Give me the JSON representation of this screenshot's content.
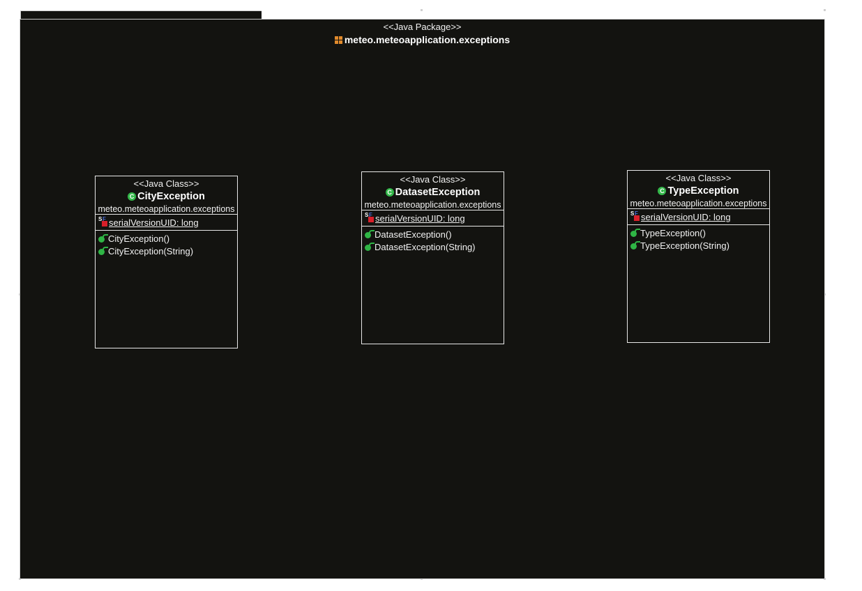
{
  "package": {
    "stereotype": "<<Java Package>>",
    "name": "meteo.meteoapplication.exceptions"
  },
  "colors": {
    "canvas": "#131310",
    "border": "#e8e8e8",
    "class_icon": "#34b84a",
    "package_icon": "#e08a2c",
    "field_icon": "#d81f2a"
  },
  "classes": [
    {
      "stereotype": "<<Java Class>>",
      "name": "CityException",
      "package": "meteo.meteoapplication.exceptions",
      "icon": "C",
      "attributes": [
        {
          "modifier_icon": "SF",
          "text": "serialVersionUID: long"
        }
      ],
      "operations": [
        "CityException()",
        "CityException(String)"
      ]
    },
    {
      "stereotype": "<<Java Class>>",
      "name": "DatasetException",
      "package": "meteo.meteoapplication.exceptions",
      "icon": "C",
      "attributes": [
        {
          "modifier_icon": "SF",
          "text": "serialVersionUID: long"
        }
      ],
      "operations": [
        "DatasetException()",
        "DatasetException(String)"
      ]
    },
    {
      "stereotype": "<<Java Class>>",
      "name": "TypeException",
      "package": "meteo.meteoapplication.exceptions",
      "icon": "C",
      "attributes": [
        {
          "modifier_icon": "SF",
          "text": "serialVersionUID: long"
        }
      ],
      "operations": [
        "TypeException()",
        "TypeException(String)"
      ]
    }
  ]
}
